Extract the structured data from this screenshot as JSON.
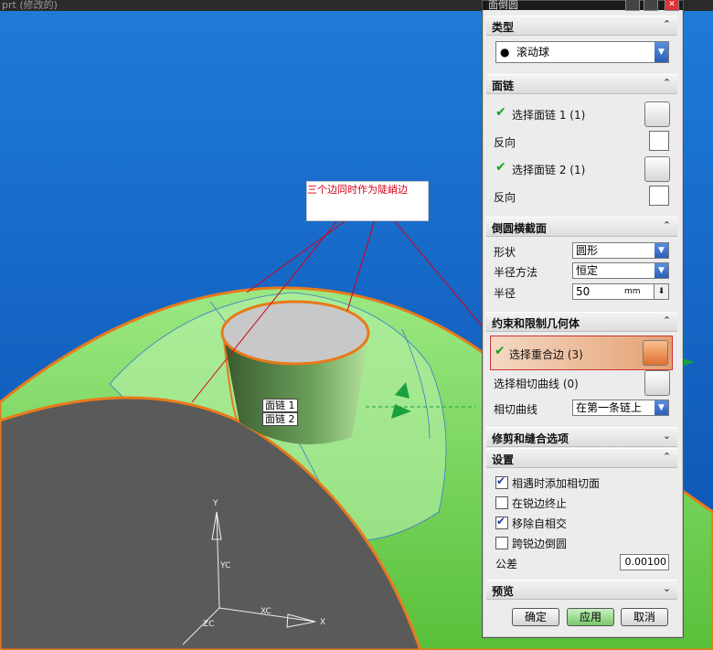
{
  "viewport": {
    "window_title": "prt (修改的)",
    "annotation_text": "三个边同时作为陡峭边",
    "tag1": "面链 1",
    "tag2": "面链 2",
    "axis": {
      "y": "Y",
      "yc": "YC",
      "xc": "XC",
      "x": "X",
      "zc": "ZC"
    }
  },
  "dialog": {
    "title": "面倒圆",
    "sections": {
      "type": {
        "header": "类型",
        "value": "滚动球"
      },
      "face_chain": {
        "header": "面链",
        "chain1": "选择面链 1 (1)",
        "reverse1": "反向",
        "chain2": "选择面链 2 (1)",
        "reverse2": "反向"
      },
      "cross_section": {
        "header": "倒圆横截面",
        "shape_label": "形状",
        "shape_value": "圆形",
        "radius_method_label": "半径方法",
        "radius_method_value": "恒定",
        "radius_label": "半径",
        "radius_value": "50",
        "radius_unit": "mm"
      },
      "constraints": {
        "header": "约束和限制几何体",
        "coincident_edge": "选择重合边 (3)",
        "tangent_curve": "选择相切曲线 (0)",
        "tangent_curve_label": "相切曲线",
        "tangent_curve_value": "在第一条链上"
      },
      "trim": {
        "header": "修剪和缝合选项"
      },
      "settings": {
        "header": "设置",
        "opt1": "相遇时添加相切面",
        "opt2": "在锐边终止",
        "opt3": "移除自相交",
        "opt4": "跨锐边倒圆",
        "tolerance_label": "公差",
        "tolerance_value": "0.00100"
      },
      "preview": {
        "header": "预览"
      }
    },
    "buttons": {
      "ok": "确定",
      "apply": "应用",
      "cancel": "取消"
    }
  }
}
